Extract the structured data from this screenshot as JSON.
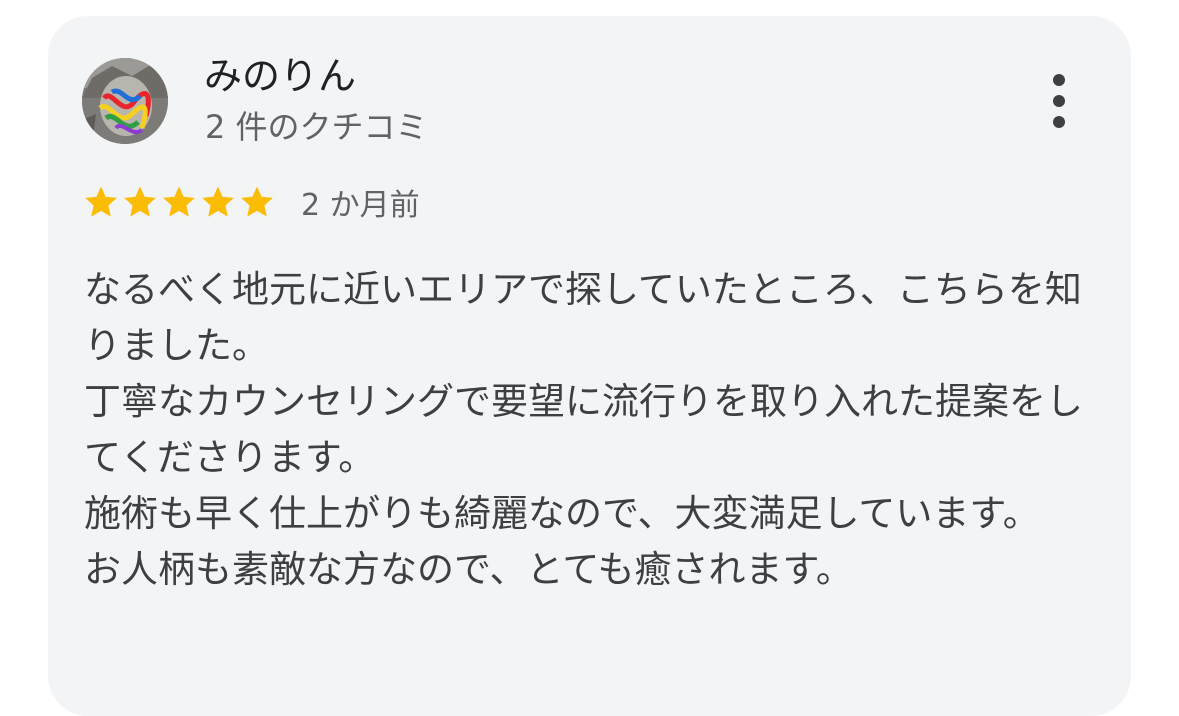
{
  "review": {
    "reviewer_name": "みのりん",
    "review_count": "2 件のクチコミ",
    "rating": 5,
    "rating_max": 5,
    "date": "2 か月前",
    "paragraphs": [
      "なるべく地元に近いエリアで探していたところ、こちらを知りました。",
      "丁寧なカウンセリングで要望に流行りを取り入れた提案をしてくださります。",
      "施術も早く仕上がりも綺麗なので、大変満足しています。",
      "お人柄も素敵な方なので、とても癒されます。"
    ]
  },
  "icons": {
    "avatar": "user-avatar-photo",
    "more": "more-vert-icon",
    "star": "star-filled-icon"
  },
  "colors": {
    "card_background": "#f3f4f6",
    "star": "#fbbc04",
    "primary_text": "#202124",
    "secondary_text": "#5f6368",
    "body_text": "#3c4043"
  }
}
